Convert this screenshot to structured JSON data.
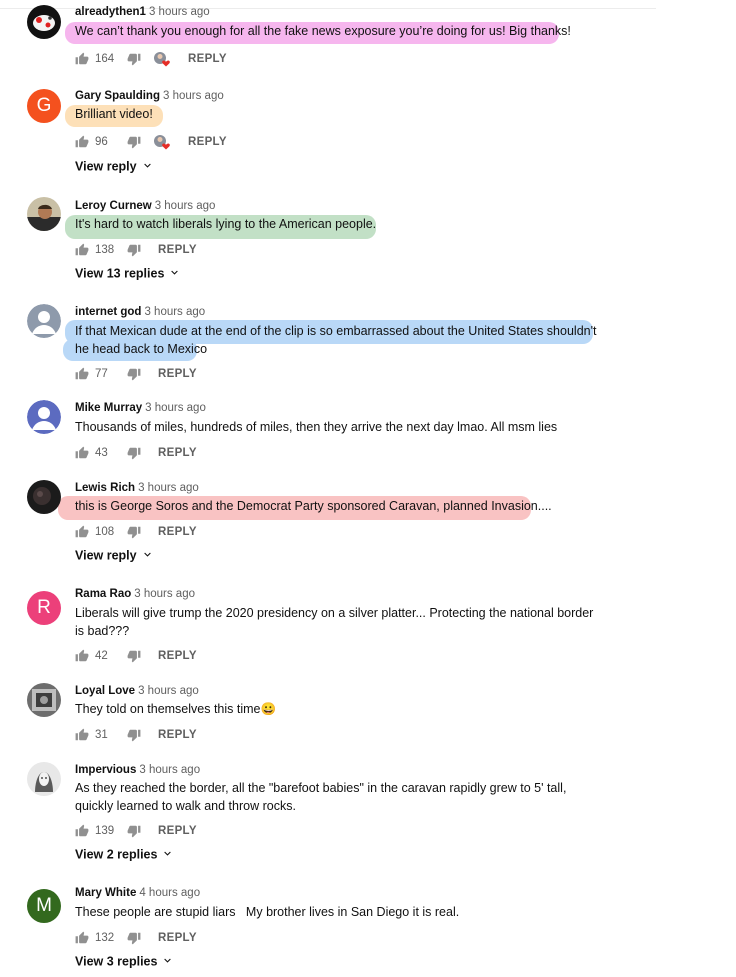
{
  "reply_label": "REPLY",
  "comments": [
    {
      "author": "alreadythen1",
      "time": "3 hours ago",
      "text": "We can’t thank you enough for all the fake news exposure you’re doing for us! Big thanks!",
      "likes": "164",
      "highlight": "#f6b6ee",
      "creator_heart": true,
      "avatar": {
        "type": "image",
        "icon": "cartoon-avatar"
      }
    },
    {
      "author": "Gary Spaulding",
      "time": "3 hours ago",
      "text": "Brilliant video!",
      "likes": "96",
      "highlight": "#fde0b8",
      "creator_heart": true,
      "avatar": {
        "type": "letter",
        "letter": "G",
        "color": "#f4511e"
      },
      "view_replies": "View reply"
    },
    {
      "author": "Leroy Curnew",
      "time": "3 hours ago",
      "text": "It's hard to watch liberals lying to the American people.",
      "likes": "138",
      "highlight": "#c2e0c6",
      "avatar": {
        "type": "image",
        "icon": "photo-avatar"
      },
      "view_replies": "View 13 replies"
    },
    {
      "author": "internet god",
      "time": "3 hours ago",
      "text": "If that Mexican dude at the end of the clip is so embarrassed about the United States shouldn't he head back to Mexico",
      "likes": "77",
      "highlight": "#b9d8f7",
      "avatar": {
        "type": "default",
        "color": "#8e9aab"
      }
    },
    {
      "author": "Mike Murray",
      "time": "3 hours ago",
      "text": "Thousands of miles, hundreds of miles, then they arrive the next day lmao. All msm lies",
      "likes": "43",
      "avatar": {
        "type": "default",
        "color": "#5c6bc0"
      }
    },
    {
      "author": "Lewis Rich",
      "time": "3 hours ago",
      "text": "this is George Soros and the Democrat Party sponsored Caravan, planned Invasion....",
      "likes": "108",
      "highlight": "#f9c3c3",
      "avatar": {
        "type": "image",
        "icon": "dark-photo-avatar"
      },
      "view_replies": "View reply"
    },
    {
      "author": "Rama Rao",
      "time": "3 hours ago",
      "text": "Liberals will give trump the 2020 presidency on a silver platter... Protecting the national border is bad???",
      "likes": "42",
      "avatar": {
        "type": "letter",
        "letter": "R",
        "color": "#ec407a"
      }
    },
    {
      "author": "Loyal Love",
      "time": "3 hours ago",
      "text": "They told on themselves this time😀",
      "likes": "31",
      "avatar": {
        "type": "image",
        "icon": "photo-avatar-gray"
      }
    },
    {
      "author": "Impervious",
      "time": "3 hours ago",
      "text": "As they reached the border, all the \"barefoot babies\" in the caravan rapidly grew to 5' tall, quickly learned to walk and throw rocks.",
      "likes": "139",
      "avatar": {
        "type": "image",
        "icon": "sketch-avatar"
      },
      "view_replies": "View 2 replies"
    },
    {
      "author": "Mary White",
      "time": "4 hours ago",
      "text": "These people are stupid liars   My brother lives in San Diego it is real.",
      "likes": "132",
      "avatar": {
        "type": "letter",
        "letter": "M",
        "color": "#33691e"
      },
      "view_replies": "View 3 replies"
    }
  ]
}
